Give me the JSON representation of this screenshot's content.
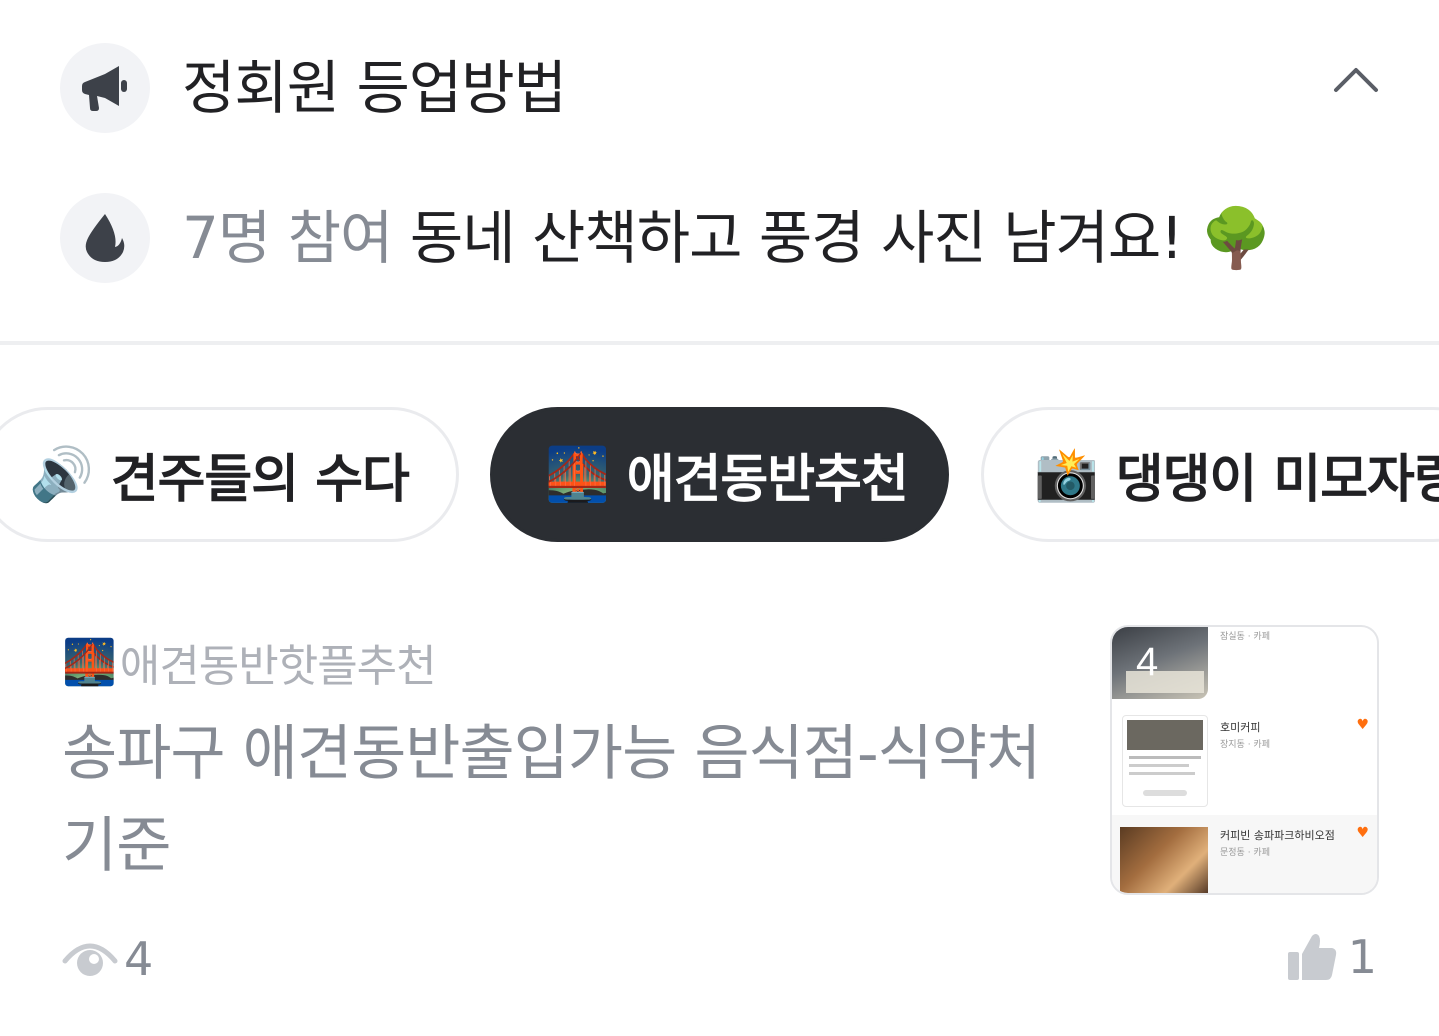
{
  "notices": {
    "rules": {
      "icon": "megaphone-icon",
      "label": "정회원 등업방법"
    },
    "challenge": {
      "icon": "flame-icon",
      "count_text": "7명 참여",
      "label": "동네 산책하고 풍경 사진 남겨요!",
      "emoji": "🌳"
    }
  },
  "chips": [
    {
      "emoji": "🔊",
      "label": "견주들의 수다",
      "selected": false
    },
    {
      "emoji": "🌉",
      "label": "애견동반추천",
      "selected": true
    },
    {
      "emoji": "📸",
      "label": "댕댕이 미모자랑",
      "selected": false
    }
  ],
  "post": {
    "board_emoji": "🌉",
    "board_name": "애견동반핫플추천",
    "title": "송파구 애견동반출입가능 음식점-식약처 기준",
    "image_count": "4",
    "thumbnail": {
      "item1_sub": "잠실동 · 카페",
      "item2_name": "호미커피",
      "item2_sub": "장지동 · 카페",
      "item3_name": "커피빈 송파파크하비오점",
      "item3_sub": "문정동 · 카페"
    },
    "views": "4",
    "likes": "1"
  },
  "colors": {
    "selected_chip_bg": "#2b2e33",
    "muted_text": "#868b94",
    "accent": "#ff6f0f"
  }
}
